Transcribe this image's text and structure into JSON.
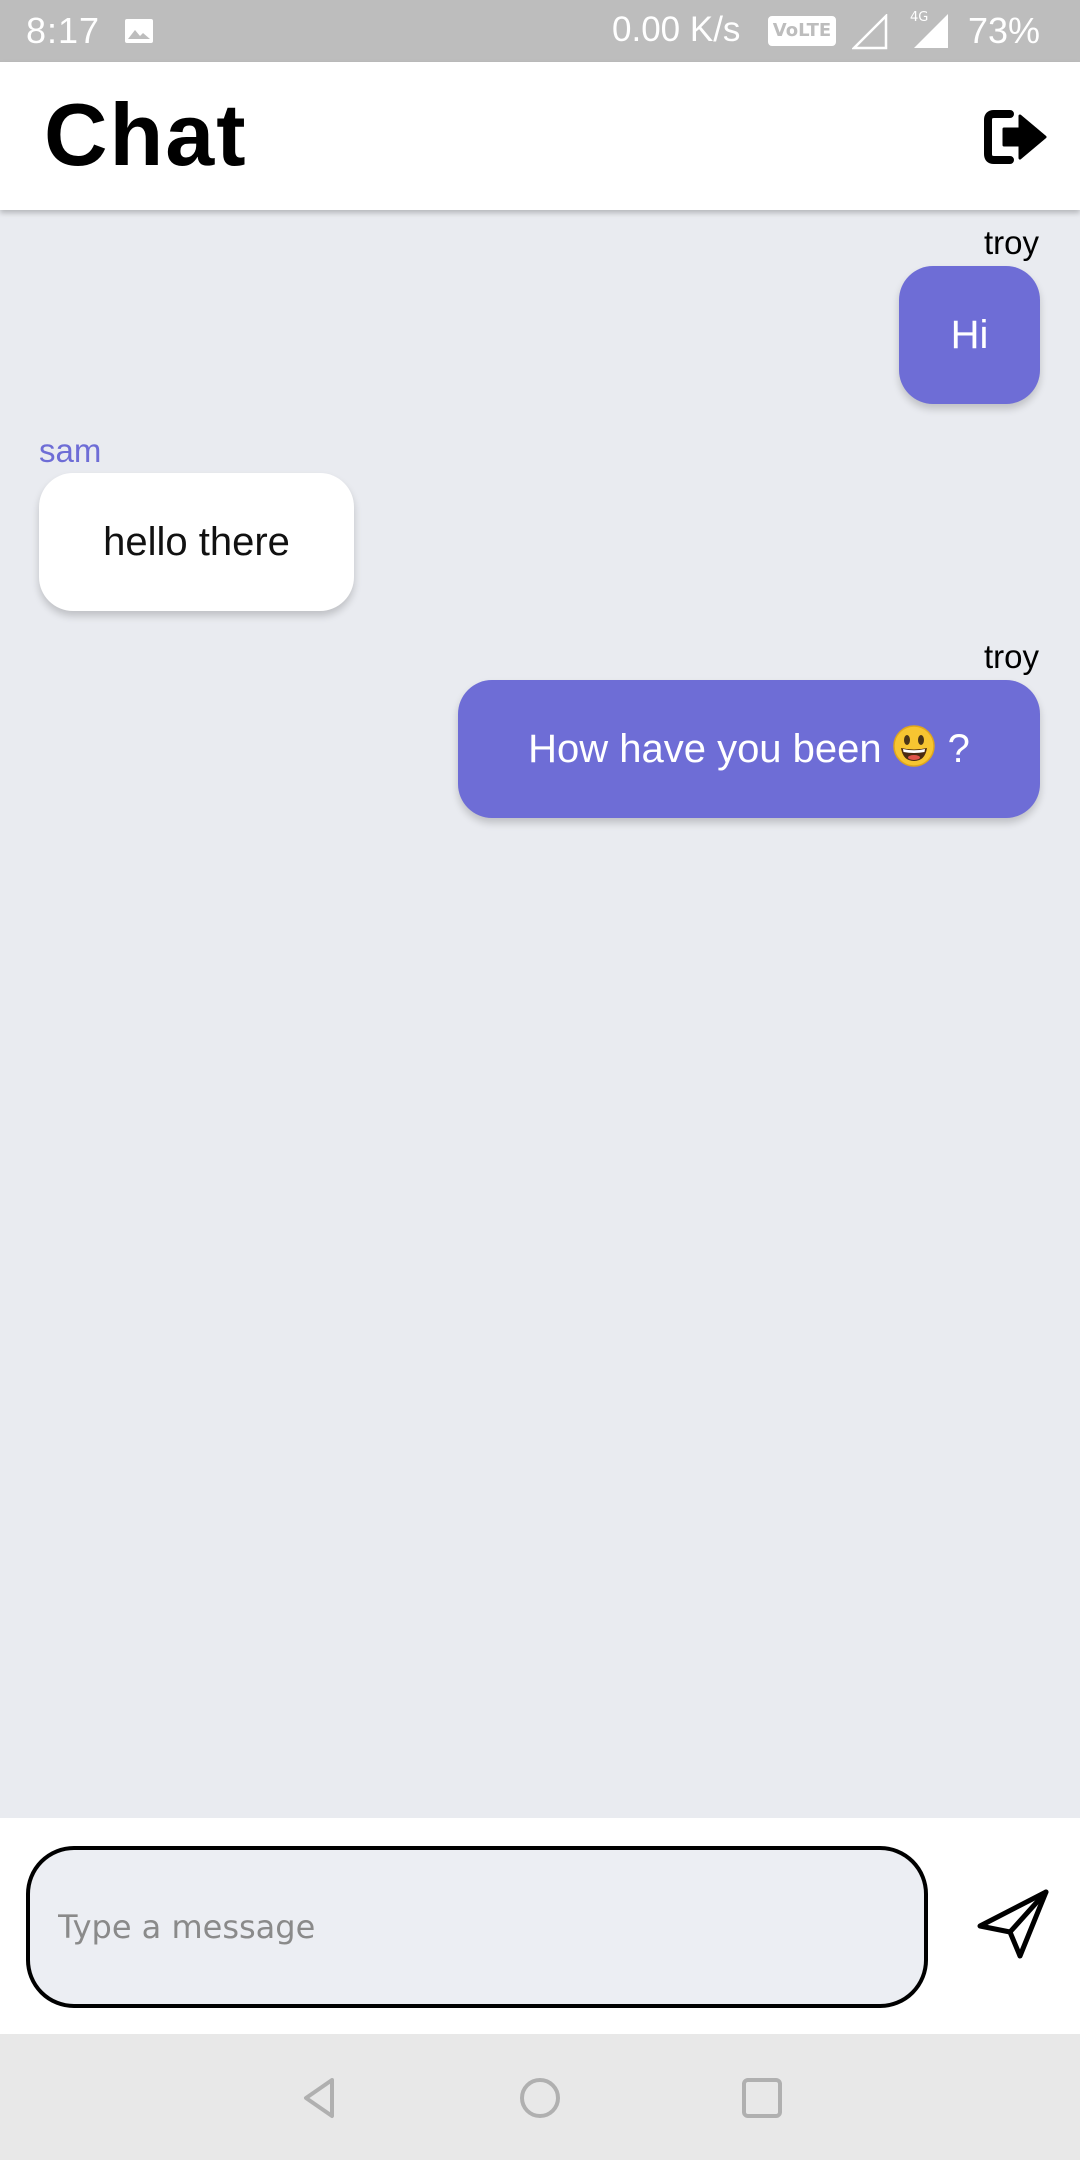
{
  "status_bar": {
    "time": "8:17",
    "net_speed": "0.00 K/s",
    "volte": "VoLTE",
    "network_type": "4G",
    "battery": "73%",
    "icons": [
      "gallery-icon",
      "signal-icon",
      "signal-4g-icon"
    ]
  },
  "header": {
    "title": "Chat",
    "logout_icon": "logout-icon"
  },
  "messages": [
    {
      "sender": "troy",
      "text": "Hi",
      "outgoing": true
    },
    {
      "sender": "sam",
      "text": "hello there",
      "outgoing": false
    },
    {
      "sender": "troy",
      "text": "How have you been",
      "emoji": "grinning-face-emoji",
      "text_after": "?",
      "outgoing": true
    }
  ],
  "composer": {
    "placeholder": "Type a message",
    "value": "",
    "send_icon": "send-icon"
  },
  "nav": {
    "icons": [
      "back-icon",
      "home-icon",
      "recents-icon"
    ]
  },
  "colors": {
    "accent": "#6e6dd6",
    "chat_background": "#e9ebf0",
    "incoming_bubble": "#ffffff",
    "incoming_sender": "#6e6dd6",
    "outgoing_sender": "#000000",
    "status_bar": "#bdbdbd",
    "nav_bar": "#e8e8e8"
  }
}
